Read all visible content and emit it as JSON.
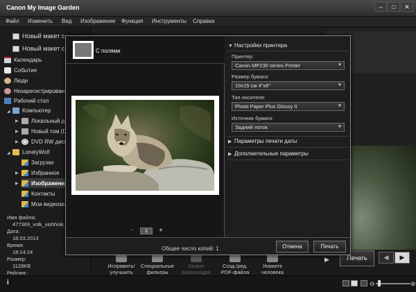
{
  "app": {
    "title": "Canon My Image Garden",
    "window_controls": [
      "‒",
      "□",
      "✕"
    ]
  },
  "menu": [
    "Файл",
    "Изменить",
    "Вид",
    "Изображение",
    "Функция",
    "Инструменты",
    "Справка"
  ],
  "sidebar": {
    "top_items": [
      "Новый макет с",
      "Новый макет с"
    ],
    "items": [
      {
        "label": "Календарь",
        "icon": "calendar-icon"
      },
      {
        "label": "Событие",
        "icon": "event-icon"
      },
      {
        "label": "Люди",
        "icon": "people-icon"
      },
      {
        "label": "Незарегистрированн",
        "icon": "unregistered-people-icon"
      },
      {
        "label": "Рабочий стол",
        "icon": "desktop-icon"
      },
      {
        "label": "Компьютер",
        "icon": "computer-icon"
      },
      {
        "label": "Локальный ди",
        "icon": "local-disk-icon"
      },
      {
        "label": "Новый том (D",
        "icon": "hdd-icon"
      },
      {
        "label": "DVD RW диск",
        "icon": "dvd-icon"
      },
      {
        "label": "LonelyWolf",
        "icon": "user-folder-icon"
      },
      {
        "label": "Загрузки",
        "icon": "downloads-folder-icon"
      },
      {
        "label": "Избранное",
        "icon": "favorites-folder-icon"
      },
      {
        "label": "Изображения",
        "icon": "pictures-folder-icon"
      },
      {
        "label": "Контакты",
        "icon": "contacts-folder-icon"
      },
      {
        "label": "Мои видеоза",
        "icon": "videos-folder-icon"
      }
    ]
  },
  "file_info": {
    "name_label": "Имя файла:",
    "name_value": "477369_volk_xishhnik_k",
    "date_label": "Дата:",
    "date_value": "18.03.2013",
    "time_label": "Время:",
    "time_value": "18:14:24",
    "size_label": "Размер:",
    "size_value": "1128KB",
    "rating_label": "Рейтинг:"
  },
  "toolbar": {
    "buttons": [
      {
        "line1": "Исправить/",
        "line2": "улучшить",
        "enabled": true
      },
      {
        "line1": "Специальные",
        "line2": "фильтры",
        "enabled": true
      },
      {
        "line1": "Захват",
        "line2": "видеокадра",
        "enabled": false
      },
      {
        "line1": "Созд./ред.",
        "line2": "PDF-файла",
        "enabled": true
      },
      {
        "line1": "Укажите",
        "line2": "человека",
        "enabled": true
      }
    ],
    "print_label": "Печать"
  },
  "dialog": {
    "layout_label": "С полями",
    "page_number": "1",
    "pager_minus": "−",
    "pager_plus": "+",
    "printer_settings_header": "Настройки принтера",
    "printer_label": "Принтер:",
    "printer_value": "Canon MP230 series Printer",
    "paper_size_label": "Размер бумаги:",
    "paper_size_value": "10x15 см 4\"x6\"",
    "media_type_label": "Тип носителя:",
    "media_type_value": "Photo Paper Plus Glossy II",
    "paper_source_label": "Источник бумаги:",
    "paper_source_value": "Задний лоток",
    "date_print_settings": "Параметры печати даты",
    "advanced_settings": "Дополнительные параметры",
    "total_copies": "Общее число копий: 1",
    "cancel_label": "Отмена",
    "print_label": "Печать"
  }
}
